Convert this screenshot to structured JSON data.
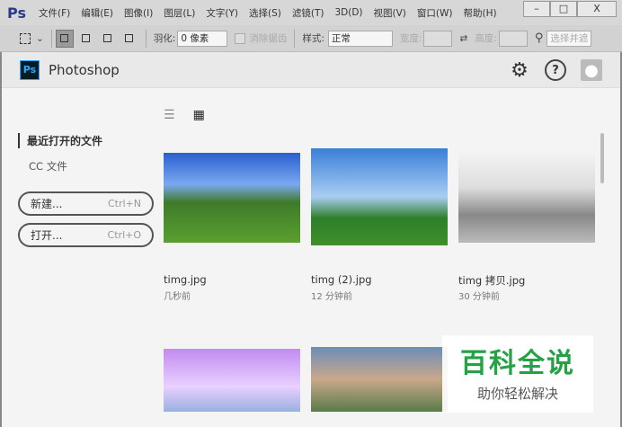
{
  "menubar": {
    "logo": "Ps",
    "items": [
      "文件(F)",
      "编辑(E)",
      "图像(I)",
      "图层(L)",
      "文字(Y)",
      "选择(S)",
      "滤镜(T)",
      "3D(D)",
      "视图(V)",
      "窗口(W)",
      "帮助(H)"
    ],
    "min": "–",
    "max": "□",
    "close": "X"
  },
  "toolbar": {
    "feather_label": "羽化:",
    "feather_value": "0 像素",
    "antialias": "消除锯齿",
    "style_label": "样式:",
    "style_value": "正常",
    "width_label": "宽度:",
    "height_label": "高度:",
    "select_mask": "选择并遮"
  },
  "app": {
    "logo": "Ps",
    "title": "Photoshop",
    "help": "?"
  },
  "sidebar": {
    "recent": "最近打开的文件",
    "cc": "CC 文件",
    "new_label": "新建...",
    "new_key": "Ctrl+N",
    "open_label": "打开...",
    "open_key": "Ctrl+O"
  },
  "files": [
    {
      "name": "timg.jpg",
      "time": "几秒前"
    },
    {
      "name": "timg (2).jpg",
      "time": "12 分钟前"
    },
    {
      "name": "timg 拷贝.jpg",
      "time": "30 分钟前"
    }
  ],
  "watermark": {
    "line1": "百科全说",
    "line2": "助你轻松解决"
  }
}
